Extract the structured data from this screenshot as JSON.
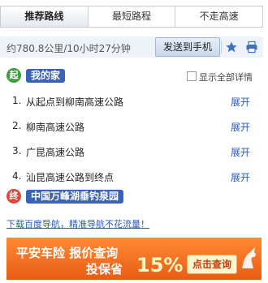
{
  "tabs": [
    {
      "label": "推荐路线",
      "active": true
    },
    {
      "label": "最短路程",
      "active": false
    },
    {
      "label": "不走高速",
      "active": false
    }
  ],
  "summary": {
    "distance_time": "约780.8公里/10小时27分钟",
    "send_label": "发送到手机"
  },
  "start": {
    "badge": "起",
    "name": "我的家",
    "show_all_label": "显示全部详情"
  },
  "steps": [
    {
      "num": "1.",
      "text": "从起点到柳南高速公路",
      "expand": "展开"
    },
    {
      "num": "2.",
      "text": "柳南高速公路",
      "expand": "展开"
    },
    {
      "num": "3.",
      "text": "广昆高速公路",
      "expand": "展开"
    },
    {
      "num": "4.",
      "text": "汕昆高速公路到终点",
      "expand": "展开"
    }
  ],
  "end": {
    "badge": "终",
    "name": "中国万峰湖垂钓泉园"
  },
  "promo_link": "下载百度导航，精准导航不花流量！",
  "banner": {
    "line1": "平安车险 报价查询",
    "line2": "投保省",
    "percent": "15%",
    "cta": "点击查询"
  },
  "colors": {
    "link": "#2a58b8",
    "start_badge": "#3c9e3a",
    "end_badge": "#d94a3c",
    "pill": "#3a62b5",
    "banner": "#f07020"
  }
}
